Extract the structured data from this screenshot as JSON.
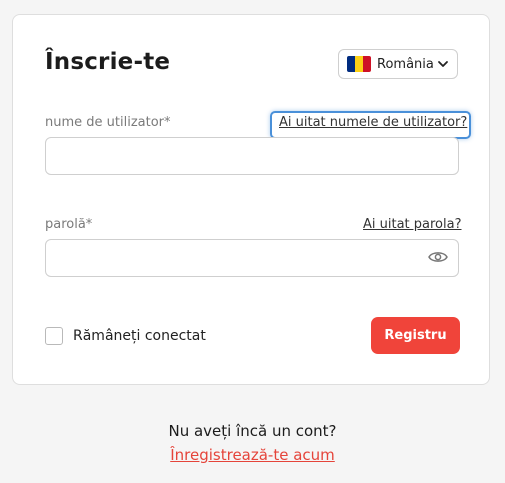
{
  "login": {
    "title": "Înscrie-te",
    "language": {
      "selected": "România",
      "flag_colors": [
        "#002B7F",
        "#FCD116",
        "#CE1126"
      ]
    },
    "username": {
      "label": "nume de utilizator*",
      "forgot_link": "Ai uitat numele de utilizator?",
      "value": ""
    },
    "password": {
      "label": "parolă*",
      "forgot_link": "Ai uitat parola?",
      "value": "",
      "toggle_icon": "eye-icon"
    },
    "remember": {
      "label": "Rămâneți conectat",
      "checked": false
    },
    "submit_label": "Registru",
    "colors": {
      "accent": "#f0443a",
      "focus_ring": "#4a90d9"
    }
  },
  "footer": {
    "prompt": "Nu aveți încă un cont?",
    "register_link": "Înregistrează-te acum"
  }
}
